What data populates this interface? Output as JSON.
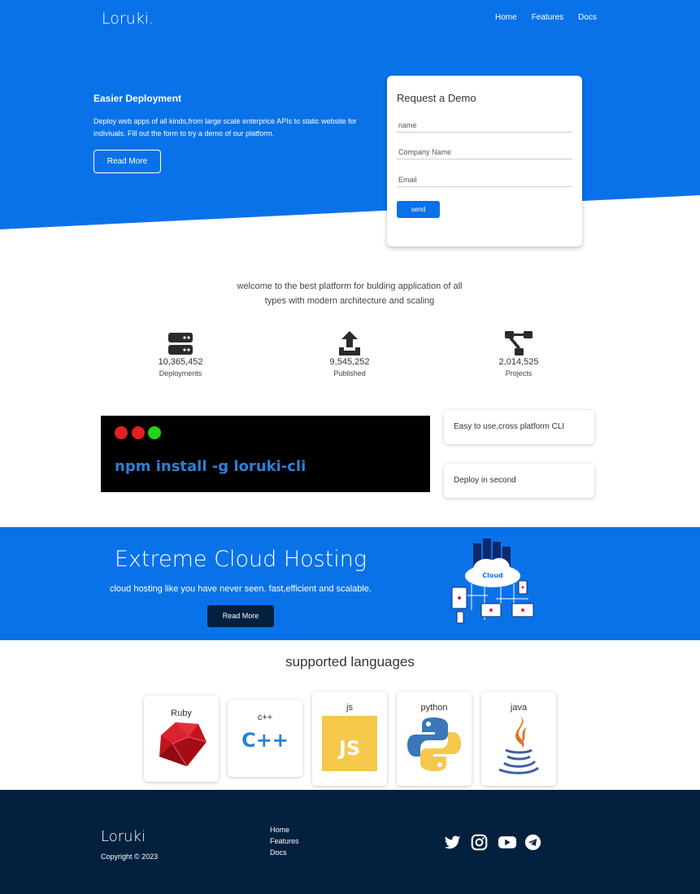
{
  "header": {
    "logo": "Loruki.",
    "nav": [
      "Home",
      "Features",
      "Docs"
    ]
  },
  "hero": {
    "title": "Easier Deployment",
    "text": "Deploy web apps of all kinds,from large scale enterprice APIs to static website for indiviuals. Fill out the form to try a demo of our platform.",
    "button": "Read More"
  },
  "demo": {
    "title": "Request a Demo",
    "fields": [
      "name",
      "Company Name",
      "Email"
    ],
    "button": "send"
  },
  "welcome": {
    "text": "welcome to the best platform for bulding application of all types with modern architecture and scaling"
  },
  "stats": [
    {
      "value": "10,365,452",
      "label": "Deployments",
      "icon": "server-icon"
    },
    {
      "value": "9,545,252",
      "label": "Published",
      "icon": "upload-icon"
    },
    {
      "value": "2,014,525",
      "label": "Projects",
      "icon": "project-diagram-icon"
    }
  ],
  "terminal": {
    "command": "npm install -g loruki-cli",
    "dots": [
      "#e0211f",
      "#e0211f",
      "#22d41a"
    ]
  },
  "features": [
    "Easy to use,cross platform CLI",
    "Deploy in second"
  ],
  "cloud": {
    "title": "Extreme Cloud Hosting",
    "text": "cloud hosting like you have never seen. fast,efficient and scalable.",
    "button": "Read More",
    "illustration_label": "Cloud"
  },
  "languages": {
    "title": "supported languages",
    "items": [
      {
        "name": "Ruby",
        "icon": "ruby-icon"
      },
      {
        "name": "c++",
        "icon": "cpp-icon",
        "logo_text": "C++"
      },
      {
        "name": "js",
        "icon": "js-icon",
        "logo_text": "JS"
      },
      {
        "name": "python",
        "icon": "python-icon"
      },
      {
        "name": "java",
        "icon": "java-icon"
      }
    ]
  },
  "footer": {
    "logo": "Loruki",
    "copyright": "Copyright © 2023",
    "links": [
      "Home",
      "Features",
      "Docs"
    ],
    "socials": [
      "twitter-icon",
      "instagram-icon",
      "youtube-icon",
      "telegram-icon"
    ]
  },
  "colors": {
    "primary": "#0a72e8",
    "dark": "#03203f"
  }
}
